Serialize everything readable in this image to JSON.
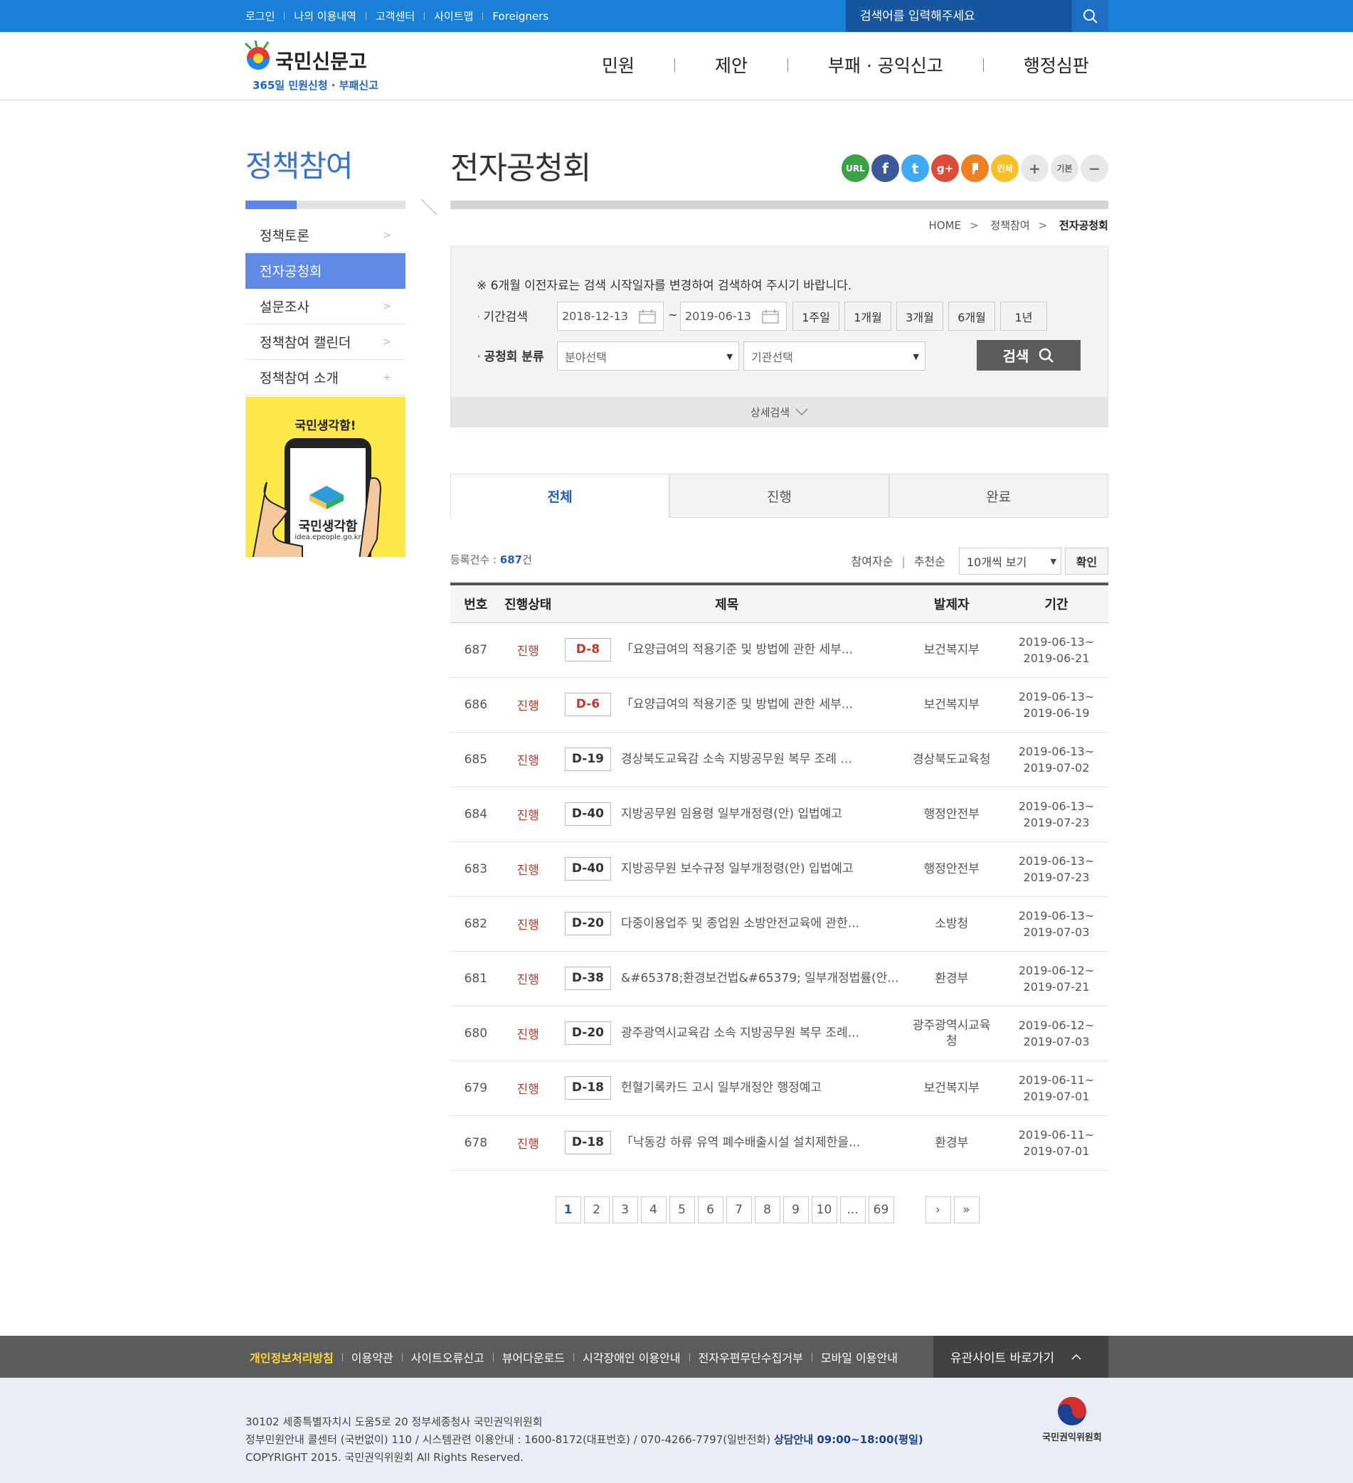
{
  "top": {
    "links": [
      "로그인",
      "나의 이용내역",
      "고객센터",
      "사이트맵",
      "Foreigners"
    ],
    "search_placeholder": "검색어를 입력해주세요"
  },
  "logo": {
    "name": "국민신문고",
    "slogan": "365일 민원신청 · 부패신고"
  },
  "gnb": [
    "민원",
    "제안",
    "부패 · 공익신고",
    "행정심판"
  ],
  "lnb": {
    "title": "정책참여",
    "items": [
      {
        "label": "정책토론",
        "arrow": ">"
      },
      {
        "label": "전자공청회",
        "arrow": ""
      },
      {
        "label": "설문조사",
        "arrow": ">"
      },
      {
        "label": "정책참여 캘린더",
        "arrow": ">"
      },
      {
        "label": "정책참여 소개",
        "arrow": "+"
      }
    ],
    "banner_title": "국민생각함!",
    "banner_name": "국민생각함",
    "banner_url": "idea.epeople.go.kr"
  },
  "page": {
    "title": "전자공청회",
    "sns": [
      "URL",
      "f",
      "t",
      "g+",
      "",
      "인쇄",
      "+",
      "기본",
      "−"
    ],
    "breadcrumb": [
      "HOME",
      "정책참여",
      "전자공청회"
    ]
  },
  "search": {
    "notice": "※ 6개월 이전자료는 검색 시작일자를 변경하여 검색하여 주시기 바랍니다.",
    "period_label": "기간검색",
    "date_from": "2018-12-13",
    "tilde": "~",
    "date_to": "2019-06-13",
    "presets": [
      "1주일",
      "1개월",
      "3개월",
      "6개월",
      "1년"
    ],
    "category_label": "공청회 분류",
    "field_select": "분야선택",
    "org_select": "기관선택",
    "search_button": "검색",
    "detail_toggle": "상세검색"
  },
  "tabs": [
    "전체",
    "진행",
    "완료"
  ],
  "list": {
    "count_prefix": "등록건수 : ",
    "count": "687",
    "count_suffix": "건",
    "sort": [
      "참여자순",
      "추천순"
    ],
    "sort_sep": "|",
    "per_page": "10개씩 보기",
    "confirm": "확인",
    "headers": [
      "번호",
      "진행상태",
      "제목",
      "발제자",
      "기간"
    ],
    "rows": [
      {
        "no": "687",
        "status": "진행",
        "dday": "D-8",
        "red": true,
        "title": "「요양급여의 적용기준 및 방법에 관한 세부...",
        "org": "보건복지부",
        "period": "2019-06-13~\n2019-06-21"
      },
      {
        "no": "686",
        "status": "진행",
        "dday": "D-6",
        "red": true,
        "title": "「요양급여의 적용기준 및 방법에 관한 세부...",
        "org": "보건복지부",
        "period": "2019-06-13~\n2019-06-19"
      },
      {
        "no": "685",
        "status": "진행",
        "dday": "D-19",
        "red": false,
        "title": "경상북도교육감 소속 지방공무원 복무 조례 ...",
        "org": "경상북도교육청",
        "period": "2019-06-13~\n2019-07-02"
      },
      {
        "no": "684",
        "status": "진행",
        "dday": "D-40",
        "red": false,
        "title": "지방공무원 임용령 일부개정령(안) 입법예고",
        "org": "행정안전부",
        "period": "2019-06-13~\n2019-07-23"
      },
      {
        "no": "683",
        "status": "진행",
        "dday": "D-40",
        "red": false,
        "title": "지방공무원 보수규정 일부개정령(안) 입법예고",
        "org": "행정안전부",
        "period": "2019-06-13~\n2019-07-23"
      },
      {
        "no": "682",
        "status": "진행",
        "dday": "D-20",
        "red": false,
        "title": "다중이용업주 및 종업원 소방안전교육에 관한...",
        "org": "소방청",
        "period": "2019-06-13~\n2019-07-03"
      },
      {
        "no": "681",
        "status": "진행",
        "dday": "D-38",
        "red": false,
        "title": "&#65378;환경보건법&#65379; 일부개정법률(안...",
        "org": "환경부",
        "period": "2019-06-12~\n2019-07-21"
      },
      {
        "no": "680",
        "status": "진행",
        "dday": "D-20",
        "red": false,
        "title": "광주광역시교육감 소속 지방공무원 복무 조례...",
        "org": "광주광역시교육\n청",
        "period": "2019-06-12~\n2019-07-03"
      },
      {
        "no": "679",
        "status": "진행",
        "dday": "D-18",
        "red": false,
        "title": "헌혈기록카드 고시 일부개정안 행정예고",
        "org": "보건복지부",
        "period": "2019-06-11~\n2019-07-01"
      },
      {
        "no": "678",
        "status": "진행",
        "dday": "D-18",
        "red": false,
        "title": "「낙동강 하류 유역 폐수배출시설 설치제한을...",
        "org": "환경부",
        "period": "2019-06-11~\n2019-07-01"
      }
    ]
  },
  "paging": {
    "pages": [
      "1",
      "2",
      "3",
      "4",
      "5",
      "6",
      "7",
      "8",
      "9",
      "10",
      "...",
      "69"
    ],
    "current": "1",
    "next": "›",
    "last": "»"
  },
  "footer": {
    "links": [
      "개인정보처리방침",
      "이용약관",
      "사이트오류신고",
      "뷰어다운로드",
      "시각장애인 이용안내",
      "전자우편무단수집거부",
      "모바일 이용안내"
    ],
    "family": "유관사이트 바로가기",
    "address": "30102 세종특별자치시 도움5로 20 정부세종청사 국민권익위원회",
    "contact": "정부민원안내 콜센터 (국번없이) 110 / 시스템관련 이용안내 : 1600-8172(대표번호) / 070-4266-7797(일반전화)",
    "hours": "상담안내 09:00~18:00(평일)",
    "copyright": "COPYRIGHT 2015. 국민권익위원회 All Rights Reserved.",
    "org": "국민권익위원회"
  },
  "colors": {
    "primary": "#1a7fd6",
    "accent": "#5f8be6",
    "status": "#c0392b",
    "highlight": "#ffd633"
  }
}
